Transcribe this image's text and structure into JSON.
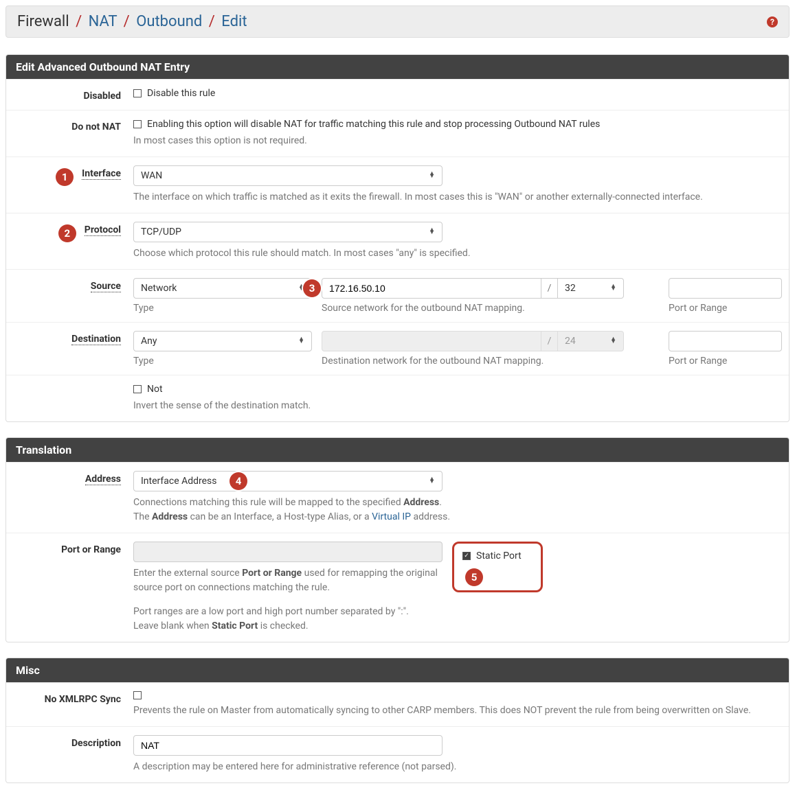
{
  "breadcrumb": {
    "root": "Firewall",
    "nat": "NAT",
    "outbound": "Outbound",
    "edit": "Edit"
  },
  "panels": {
    "edit_entry": {
      "title": "Edit Advanced Outbound NAT Entry"
    },
    "translation": {
      "title": "Translation"
    },
    "misc": {
      "title": "Misc"
    }
  },
  "markers": {
    "m1": "1",
    "m2": "2",
    "m3": "3",
    "m4": "4",
    "m5": "5"
  },
  "fields": {
    "disabled": {
      "label": "Disabled",
      "check_label": "Disable this rule",
      "checked": false
    },
    "donotnat": {
      "label": "Do not NAT",
      "check_label": "Enabling this option will disable NAT for traffic matching this rule and stop processing Outbound NAT rules",
      "hint": "In most cases this option is not required.",
      "checked": false
    },
    "interface": {
      "label": "Interface",
      "value": "WAN",
      "hint": "The interface on which traffic is matched as it exits the firewall. In most cases this is \"WAN\" or another externally-connected interface."
    },
    "protocol": {
      "label": "Protocol",
      "value": "TCP/UDP",
      "hint": "Choose which protocol this rule should match. In most cases \"any\" is specified."
    },
    "source": {
      "label": "Source",
      "type_value": "Network",
      "type_hint": "Type",
      "net_value": "172.16.50.10",
      "mask_value": "32",
      "net_hint": "Source network for the outbound NAT mapping.",
      "port_value": "",
      "port_hint": "Port or Range"
    },
    "destination": {
      "label": "Destination",
      "type_value": "Any",
      "type_hint": "Type",
      "net_value": "",
      "mask_value": "24",
      "net_hint": "Destination network for the outbound NAT mapping.",
      "port_value": "",
      "port_hint": "Port or Range",
      "not_label": "Not",
      "not_checked": false,
      "not_hint": "Invert the sense of the destination match."
    },
    "translation_address": {
      "label": "Address",
      "value": "Interface Address",
      "hint1a": "Connections matching this rule will be mapped to the specified ",
      "hint1b": "Address",
      "hint1c": ".",
      "hint2a": "The ",
      "hint2b": "Address",
      "hint2c": " can be an Interface, a Host-type Alias, or a ",
      "hint2link": "Virtual IP",
      "hint2d": " address."
    },
    "port_or_range": {
      "label": "Port or Range",
      "value": "",
      "static_label": "Static Port",
      "static_checked": true,
      "hint1a": "Enter the external source ",
      "hint1b": "Port or Range",
      "hint1c": " used for remapping the original source port on connections matching the rule.",
      "hint2": "Port ranges are a low port and high port number separated by \":\".",
      "hint3a": "Leave blank when ",
      "hint3b": "Static Port",
      "hint3c": " is checked."
    },
    "noxmlrpc": {
      "label": "No XMLRPC Sync",
      "checked": false,
      "hint": "Prevents the rule on Master from automatically syncing to other CARP members. This does NOT prevent the rule from being overwritten on Slave."
    },
    "description": {
      "label": "Description",
      "value": "NAT",
      "hint": "A description may be entered here for administrative reference (not parsed)."
    }
  }
}
